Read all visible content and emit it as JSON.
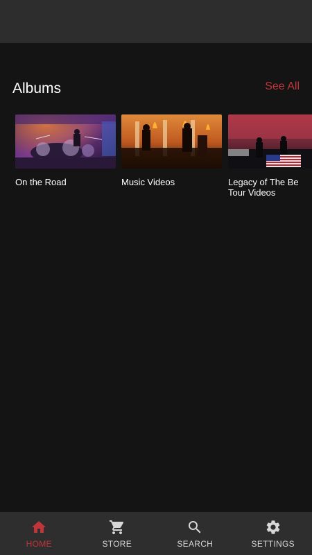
{
  "section": {
    "title": "Albums",
    "see_all": "See All"
  },
  "albums": [
    {
      "title": "On the Road"
    },
    {
      "title": "Music Videos"
    },
    {
      "title": "Legacy of The Be\nTour Videos"
    }
  ],
  "nav": {
    "items": [
      {
        "label": "HOME",
        "icon": "home-icon",
        "active": true
      },
      {
        "label": "STORE",
        "icon": "cart-icon",
        "active": false
      },
      {
        "label": "SEARCH",
        "icon": "search-icon",
        "active": false
      },
      {
        "label": "SETTINGS",
        "icon": "gear-icon",
        "active": false
      }
    ]
  },
  "colors": {
    "accent": "#c0353a",
    "background": "#141414",
    "topbar": "#2d2d2d",
    "bottom_nav": "#2e2e2e"
  }
}
